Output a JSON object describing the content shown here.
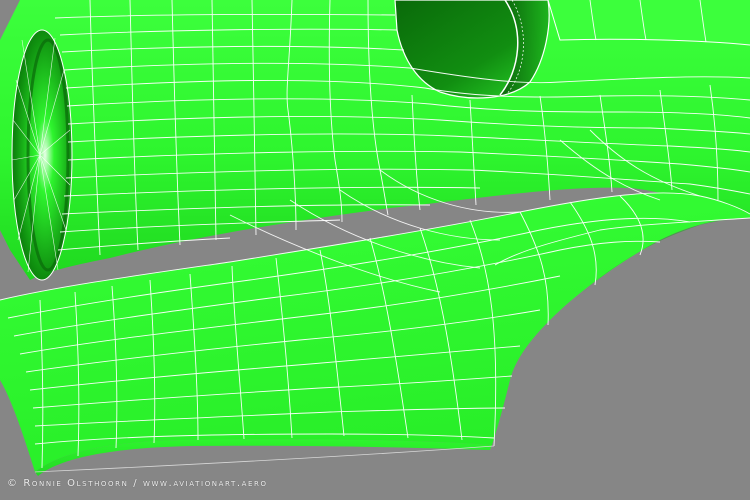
{
  "scene": {
    "subject": "3D wireframe surface model of an aircraft fuselage and wing fillet",
    "background_color": "#868686",
    "surface_color": "#2ef52e",
    "surface_shadow_color": "#0d7a0d",
    "wire_color": "#ffffff"
  },
  "watermark": {
    "text": "© Ronnie Olsthoorn / www.aviationart.aero",
    "color": "#ececec"
  }
}
